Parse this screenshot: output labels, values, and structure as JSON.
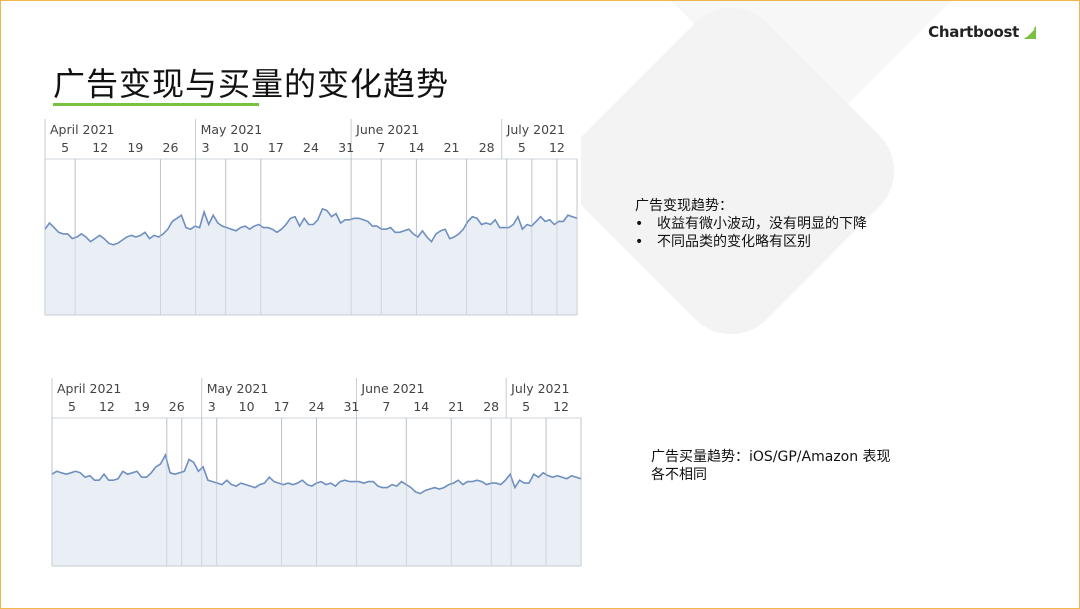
{
  "slide": {
    "title": "广告变现与买量的变化趋势",
    "logo_text": "Chartboost",
    "accent_color": "#7ac143",
    "border_color": "#f0b74a"
  },
  "notes": {
    "monetization": {
      "heading": "广告变现趋势：",
      "bullets": [
        "收益有微小波动，没有明显的下降",
        "不同品类的变化略有区别"
      ]
    },
    "user_acquisition": {
      "line1": "广告买量趋势：iOS/GP/Amazon 表现",
      "line2": "各不相同"
    }
  },
  "chart_data": [
    {
      "type": "area",
      "x_start": "2021-04-01",
      "x_end": "2021-07-16",
      "months": [
        "April 2021",
        "May 2021",
        "June 2021",
        "July 2021"
      ],
      "week_ticks": [
        "5",
        "12",
        "19",
        "26",
        "3",
        "10",
        "17",
        "24",
        "31",
        "7",
        "14",
        "21",
        "28",
        "5",
        "12"
      ],
      "line_color": "#6e8fbf",
      "fill_color": "#e6ecf4",
      "series": [
        {
          "values": [
            0.55,
            0.59,
            0.56,
            0.53,
            0.52,
            0.52,
            0.49,
            0.5,
            0.52,
            0.5,
            0.47,
            0.49,
            0.51,
            0.49,
            0.46,
            0.45,
            0.46,
            0.48,
            0.5,
            0.51,
            0.5,
            0.51,
            0.53,
            0.49,
            0.51,
            0.5,
            0.52,
            0.55,
            0.6,
            0.62,
            0.64,
            0.56,
            0.55,
            0.57,
            0.56,
            0.66,
            0.58,
            0.64,
            0.59,
            0.57,
            0.56,
            0.55,
            0.54,
            0.56,
            0.57,
            0.55,
            0.57,
            0.58,
            0.56,
            0.56,
            0.55,
            0.53,
            0.55,
            0.58,
            0.62,
            0.63,
            0.57,
            0.62,
            0.58,
            0.58,
            0.61,
            0.68,
            0.67,
            0.63,
            0.65,
            0.59,
            0.61,
            0.61,
            0.62,
            0.62,
            0.61,
            0.6,
            0.57,
            0.57,
            0.55,
            0.55,
            0.56,
            0.53,
            0.53,
            0.54,
            0.55,
            0.52,
            0.5,
            0.54,
            0.5,
            0.47,
            0.52,
            0.54,
            0.55,
            0.49,
            0.5,
            0.52,
            0.55,
            0.6,
            0.63,
            0.62,
            0.58,
            0.59,
            0.58,
            0.61,
            0.56,
            0.56,
            0.56,
            0.58,
            0.63,
            0.55,
            0.58,
            0.57,
            0.6,
            0.63,
            0.6,
            0.61,
            0.58,
            0.6,
            0.6,
            0.64,
            0.63,
            0.62
          ]
        }
      ]
    },
    {
      "type": "area",
      "x_start": "2021-04-01",
      "x_end": "2021-07-16",
      "months": [
        "April 2021",
        "May 2021",
        "June 2021",
        "July 2021"
      ],
      "week_ticks": [
        "5",
        "12",
        "19",
        "26",
        "3",
        "10",
        "17",
        "24",
        "31",
        "7",
        "14",
        "21",
        "28",
        "5",
        "12"
      ],
      "line_color": "#6e8fbf",
      "fill_color": "#e6ecf4",
      "series": [
        {
          "values": [
            0.62,
            0.64,
            0.63,
            0.62,
            0.63,
            0.64,
            0.63,
            0.6,
            0.61,
            0.58,
            0.58,
            0.62,
            0.58,
            0.58,
            0.59,
            0.64,
            0.62,
            0.63,
            0.64,
            0.6,
            0.6,
            0.63,
            0.67,
            0.69,
            0.75,
            0.63,
            0.62,
            0.63,
            0.64,
            0.72,
            0.7,
            0.64,
            0.67,
            0.58,
            0.57,
            0.56,
            0.55,
            0.58,
            0.55,
            0.54,
            0.56,
            0.55,
            0.54,
            0.53,
            0.55,
            0.56,
            0.6,
            0.57,
            0.56,
            0.55,
            0.56,
            0.55,
            0.56,
            0.58,
            0.55,
            0.54,
            0.56,
            0.57,
            0.55,
            0.56,
            0.54,
            0.57,
            0.58,
            0.57,
            0.57,
            0.57,
            0.56,
            0.57,
            0.57,
            0.54,
            0.53,
            0.53,
            0.55,
            0.54,
            0.57,
            0.55,
            0.53,
            0.5,
            0.49,
            0.51,
            0.52,
            0.53,
            0.52,
            0.53,
            0.55,
            0.56,
            0.58,
            0.55,
            0.57,
            0.57,
            0.58,
            0.57,
            0.55,
            0.56,
            0.56,
            0.55,
            0.58,
            0.62,
            0.53,
            0.58,
            0.56,
            0.56,
            0.62,
            0.6,
            0.63,
            0.61,
            0.6,
            0.61,
            0.6,
            0.59,
            0.61,
            0.6,
            0.59
          ]
        }
      ]
    }
  ]
}
